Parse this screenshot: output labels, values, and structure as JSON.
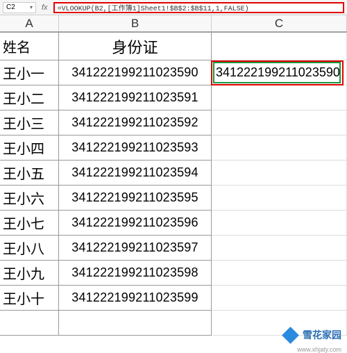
{
  "nameBox": "C2",
  "formula": "=VLOOKUP(B2,[工作簿1]Sheet1!$B$2:$B$11,1,FALSE)",
  "columns": {
    "a": "A",
    "b": "B",
    "c": "C"
  },
  "headers": {
    "name": "姓名",
    "id": "身份证"
  },
  "rows": [
    {
      "name": "王小一",
      "id": "341222199211023590",
      "c": "341222199211023590"
    },
    {
      "name": "王小二",
      "id": "341222199211023591",
      "c": ""
    },
    {
      "name": "王小三",
      "id": "341222199211023592",
      "c": ""
    },
    {
      "name": "王小四",
      "id": "341222199211023593",
      "c": ""
    },
    {
      "name": "王小五",
      "id": "341222199211023594",
      "c": ""
    },
    {
      "name": "王小六",
      "id": "341222199211023595",
      "c": ""
    },
    {
      "name": "王小七",
      "id": "341222199211023596",
      "c": ""
    },
    {
      "name": "王小八",
      "id": "341222199211023597",
      "c": ""
    },
    {
      "name": "王小九",
      "id": "341222199211023598",
      "c": ""
    },
    {
      "name": "王小十",
      "id": "341222199211023599",
      "c": ""
    }
  ],
  "watermark": {
    "text": "雪花家园",
    "url": "www.xhjaty.com"
  }
}
